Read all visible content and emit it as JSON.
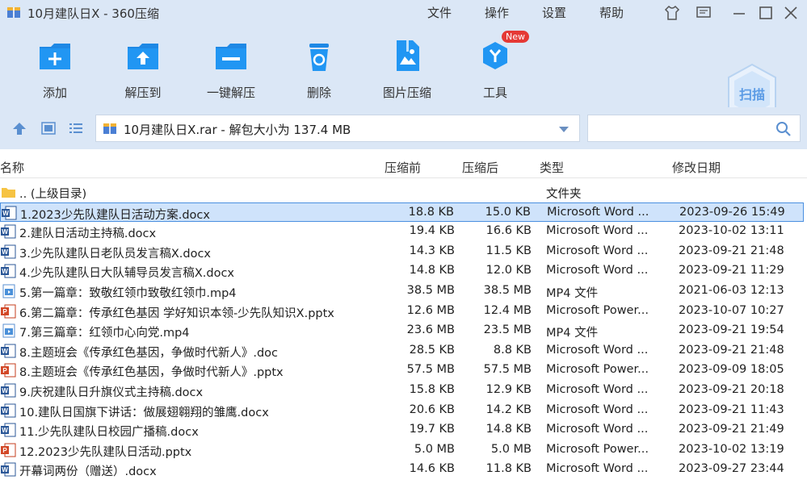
{
  "window": {
    "title": "10月建队日X - 360压缩",
    "menu": [
      "文件",
      "操作",
      "设置",
      "帮助"
    ]
  },
  "toolbar": {
    "items": [
      {
        "label": "添加",
        "icon": "add-folder-icon"
      },
      {
        "label": "解压到",
        "icon": "extract-to-icon"
      },
      {
        "label": "一键解压",
        "icon": "one-click-extract-icon"
      },
      {
        "label": "删除",
        "icon": "recycle-bin-icon"
      },
      {
        "label": "图片压缩",
        "icon": "image-compress-icon"
      },
      {
        "label": "工具",
        "icon": "tools-icon",
        "badge": "New"
      }
    ],
    "scan_label": "扫描"
  },
  "address": {
    "path": "10月建队日X.rar - 解包大小为 137.4 MB",
    "search_placeholder": ""
  },
  "columns": {
    "name": "名称",
    "packed": "压缩前",
    "size": "压缩后",
    "type": "类型",
    "modified": "修改日期"
  },
  "parent": {
    "name": ".. (上级目录)",
    "type": "文件夹"
  },
  "files": [
    {
      "name": "1.2023少先队建队日活动方案.docx",
      "packed": "18.8 KB",
      "size": "15.0 KB",
      "type": "Microsoft Word ...",
      "date": "2023-09-26 15:49",
      "kind": "word"
    },
    {
      "name": "2.建队日活动主持稿.docx",
      "packed": "19.4 KB",
      "size": "16.6 KB",
      "type": "Microsoft Word ...",
      "date": "2023-10-02 13:11",
      "kind": "word"
    },
    {
      "name": "3.少先队建队日老队员发言稿X.docx",
      "packed": "14.3 KB",
      "size": "11.5 KB",
      "type": "Microsoft Word ...",
      "date": "2023-09-21 21:48",
      "kind": "word"
    },
    {
      "name": "4.少先队建队日大队辅导员发言稿X.docx",
      "packed": "14.8 KB",
      "size": "12.0 KB",
      "type": "Microsoft Word ...",
      "date": "2023-09-21 11:29",
      "kind": "word"
    },
    {
      "name": "5.第一篇章：致敬红领巾致敬红领巾.mp4",
      "packed": "38.5 MB",
      "size": "38.5 MB",
      "type": "MP4 文件",
      "date": "2021-06-03 12:13",
      "kind": "video"
    },
    {
      "name": "6.第二篇章：传承红色基因 学好知识本领-少先队知识X.pptx",
      "packed": "12.6 MB",
      "size": "12.4 MB",
      "type": "Microsoft Power...",
      "date": "2023-10-07 10:27",
      "kind": "ppt"
    },
    {
      "name": "7.第三篇章：红领巾心向党.mp4",
      "packed": "23.6 MB",
      "size": "23.5 MB",
      "type": "MP4 文件",
      "date": "2023-09-21 19:54",
      "kind": "video"
    },
    {
      "name": "8.主题班会《传承红色基因，争做时代新人》.doc",
      "packed": "28.5 KB",
      "size": "8.8 KB",
      "type": "Microsoft Word ...",
      "date": "2023-09-21 21:48",
      "kind": "word"
    },
    {
      "name": "8.主题班会《传承红色基因，争做时代新人》.pptx",
      "packed": "57.5 MB",
      "size": "57.5 MB",
      "type": "Microsoft Power...",
      "date": "2023-09-09 18:05",
      "kind": "ppt"
    },
    {
      "name": "9.庆祝建队日升旗仪式主持稿.docx",
      "packed": "15.8 KB",
      "size": "12.9 KB",
      "type": "Microsoft Word ...",
      "date": "2023-09-21 20:18",
      "kind": "word"
    },
    {
      "name": "10.建队日国旗下讲话：做展翅翱翔的雏鹰.docx",
      "packed": "20.6 KB",
      "size": "14.2 KB",
      "type": "Microsoft Word ...",
      "date": "2023-09-21 11:43",
      "kind": "word"
    },
    {
      "name": "11.少先队建队日校园广播稿.docx",
      "packed": "19.7 KB",
      "size": "14.8 KB",
      "type": "Microsoft Word ...",
      "date": "2023-09-21 21:49",
      "kind": "word"
    },
    {
      "name": "12.2023少先队建队日活动.pptx",
      "packed": "5.0 MB",
      "size": "5.0 MB",
      "type": "Microsoft Power...",
      "date": "2023-10-02 13:19",
      "kind": "ppt"
    },
    {
      "name": "开幕词两份（赠送）.docx",
      "packed": "14.6 KB",
      "size": "11.8 KB",
      "type": "Microsoft Word ...",
      "date": "2023-09-27 23:44",
      "kind": "word"
    }
  ],
  "selected_index": 0,
  "colors": {
    "chrome": "#dbe7f6",
    "accent": "#1e88e5",
    "selection": "#cfe3fb"
  }
}
